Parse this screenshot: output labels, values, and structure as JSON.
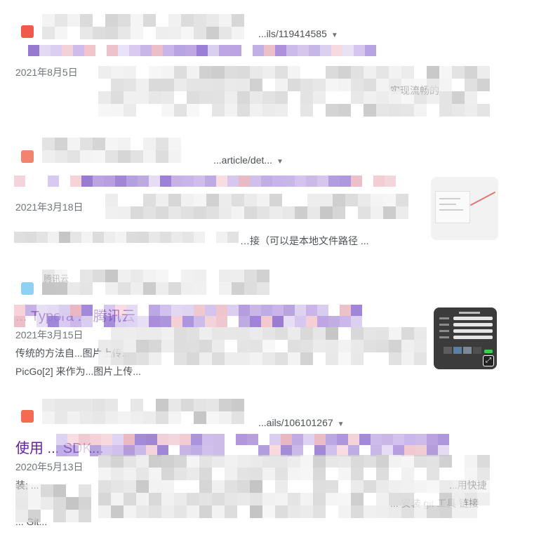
{
  "results": [
    {
      "breadcrumb": "...ils/119414585",
      "title": "",
      "date": "2021年8月5日",
      "snippet_lines": [
        "",
        "实现流畅的"
      ],
      "favicon_color": "#f15a4a"
    },
    {
      "breadcrumb": "...article/det...",
      "title": "",
      "date": "2021年3月18日",
      "snippet_lines": [
        "",
        "…接（可以是本地文件路径 ..."
      ],
      "favicon_color": "#f2836f",
      "has_thumbnail": true
    },
    {
      "site_name": "腾讯云",
      "breadcrumb": "",
      "title": "... Typora ... 腾讯云",
      "date": "2021年3月15日",
      "snippet_lines": [
        "传统的方法自...图片上传...",
        "PicGo[2] 来作为...图片上传..."
      ],
      "favicon_color": "#8fd0f5",
      "has_thumbnail": true
    },
    {
      "breadcrumb": "...ails/106101267",
      "title": "使用 ... SDK...",
      "date": "2020年5月13日",
      "snippet_lines": [
        "装; ...",
        "...用快捷",
        "... 安装 git 工具 链接",
        "... Git..."
      ],
      "favicon_color": "#f56a52"
    }
  ],
  "icons": {
    "dropdown": "caret-down-icon",
    "expand": "expand-icon"
  },
  "colors": {
    "link": "#1a0dab",
    "visited": "#681da8",
    "date": "#70757a",
    "snippet": "#4d5156"
  }
}
